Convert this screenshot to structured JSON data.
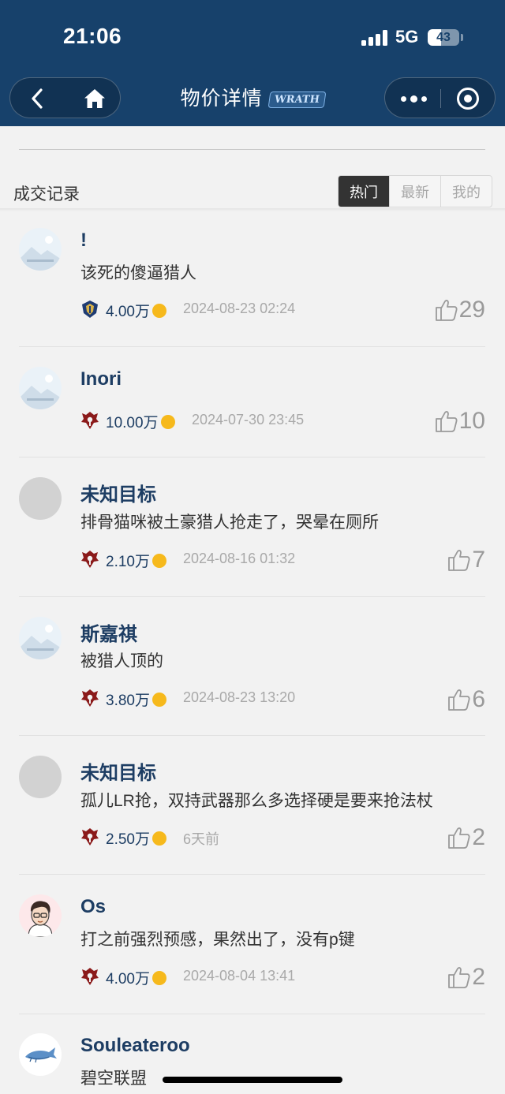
{
  "status_bar": {
    "time": "21:06",
    "network": "5G",
    "battery": "43",
    "battery_level_percent": 43
  },
  "nav": {
    "back_icon": "chevron-left-icon",
    "home_icon": "home-icon",
    "title": "物价详情",
    "title_logo_text": "WRATH",
    "more_icon": "more-dots-icon",
    "capsule_close_icon": "target-icon"
  },
  "section": {
    "title": "成交记录",
    "tabs": [
      {
        "label": "热门",
        "active": true
      },
      {
        "label": "最新",
        "active": false
      },
      {
        "label": "我的",
        "active": false
      }
    ]
  },
  "records": [
    {
      "name": "!",
      "text": "该死的傻逼猎人",
      "faction": "alliance",
      "price": "4.00万",
      "time": "2024-08-23 02:24",
      "likes": "29",
      "avatar": "placeholder"
    },
    {
      "name": "Inori",
      "text": "",
      "faction": "horde",
      "price": "10.00万",
      "time": "2024-07-30 23:45",
      "likes": "10",
      "avatar": "placeholder"
    },
    {
      "name": "未知目标",
      "text": "排骨猫咪被土豪猎人抢走了，哭晕在厕所",
      "faction": "horde",
      "price": "2.10万",
      "time": "2024-08-16 01:32",
      "likes": "7",
      "avatar": "gray"
    },
    {
      "name": "斯嘉祺",
      "text": "被猎人顶的",
      "faction": "horde",
      "price": "3.80万",
      "time": "2024-08-23 13:20",
      "likes": "6",
      "avatar": "placeholder"
    },
    {
      "name": "未知目标",
      "text": "孤儿LR抢，双持武器那么多选择硬是要来抢法杖",
      "faction": "horde",
      "price": "2.50万",
      "time": "6天前",
      "likes": "2",
      "avatar": "gray"
    },
    {
      "name": "Os",
      "text": "打之前强烈预感，果然出了，没有p键",
      "faction": "horde",
      "price": "4.00万",
      "time": "2024-08-04 13:41",
      "likes": "2",
      "avatar": "person"
    },
    {
      "name": "Souleateroo",
      "text": "碧空联盟",
      "avatar": "whale"
    }
  ],
  "colors": {
    "header_bg": "#17416b",
    "name_color": "#1d3d63",
    "coin": "#f6b91c",
    "horde": "#8b1a1a",
    "alliance": "#1f3c73",
    "muted": "#a9a9a9"
  }
}
